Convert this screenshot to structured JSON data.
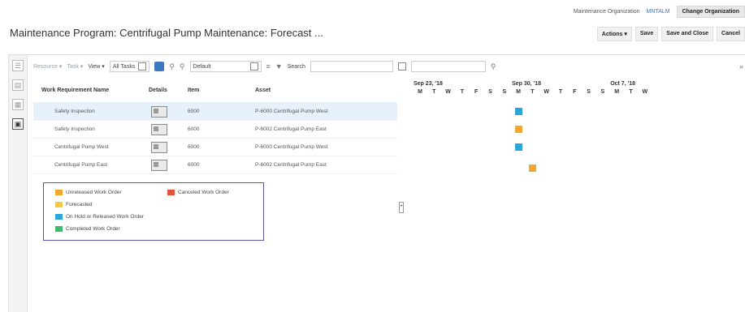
{
  "topbar": {
    "org_label": "Maintenance Organization",
    "org_code": "MNTALM",
    "change_org": "Change Organization"
  },
  "page": {
    "title": "Maintenance Program: Centrifugal Pump Maintenance: Forecast ..."
  },
  "actions": {
    "actions_label": "Actions",
    "save": "Save",
    "save_close": "Save and Close",
    "cancel": "Cancel"
  },
  "toolbar": {
    "resource": "Resource",
    "task": "Task",
    "view": "View",
    "all_tasks": "All Tasks",
    "default": "Default",
    "search_label": "Search"
  },
  "columns": {
    "name": "Work Requirement Name",
    "details": "Details",
    "item": "Item",
    "asset": "Asset"
  },
  "rows": [
    {
      "name": "Safety Inspection",
      "item": "6000",
      "asset": "P-6000 Centrifugal Pump West"
    },
    {
      "name": "Safety Inspection",
      "item": "6000",
      "asset": "P-6002 Centrifugal Pump East"
    },
    {
      "name": "Centrifugal Pump West",
      "item": "6000",
      "asset": "P-6000 Centrifugal Pump West"
    },
    {
      "name": "Centrifugal Pump East",
      "item": "6000",
      "asset": "P-6002 Centrifugal Pump East"
    }
  ],
  "legend": {
    "unreleased": "Unreleased Work Order",
    "canceled": "Canceled Work Order",
    "forecasted": "Forecasted",
    "on_hold": "On Hold or Released Work Order",
    "completed": "Completed Work Order"
  },
  "colors": {
    "unreleased": "#f0a830",
    "canceled": "#e2553a",
    "forecasted": "#f5c842",
    "on_hold": "#2aa7d8",
    "completed": "#3dba6b",
    "accent": "#3b78c2"
  },
  "gantt": {
    "weeks": [
      "Sep 23, '18",
      "Sep 30, '18",
      "Oct 7, '18"
    ],
    "days": [
      "M",
      "T",
      "W",
      "T",
      "F",
      "S",
      "S",
      "M",
      "T",
      "W",
      "T",
      "F",
      "S",
      "S",
      "M",
      "T",
      "W"
    ],
    "bars": [
      {
        "row": 0,
        "day": 7,
        "status": "on_hold"
      },
      {
        "row": 1,
        "day": 7,
        "status": "unreleased"
      },
      {
        "row": 2,
        "day": 7,
        "status": "on_hold"
      },
      {
        "row": 3,
        "day": 8,
        "status": "unreleased"
      }
    ]
  },
  "icons": {
    "side_tabs": [
      "list-icon",
      "document-icon",
      "calendar-icon",
      "gantt-icon"
    ],
    "toolbar": [
      "dropdown-icon",
      "gantt-view-icon",
      "zoom-in-icon",
      "zoom-out-icon",
      "columns-icon",
      "filter-icon",
      "search-icon",
      "expand-icon"
    ]
  }
}
